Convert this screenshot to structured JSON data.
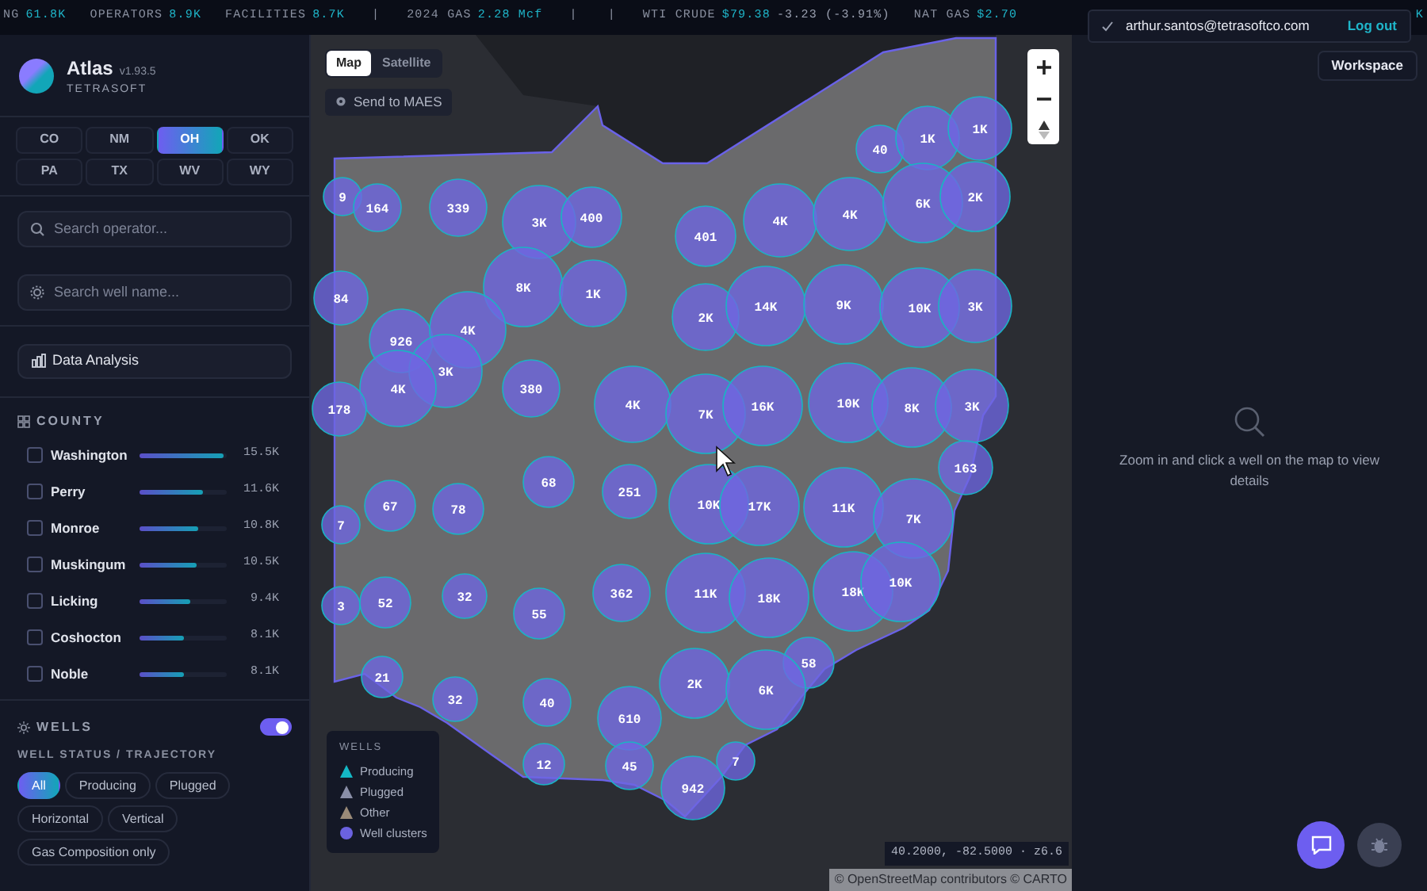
{
  "ticker": [
    {
      "kind": "stat",
      "label": "NG",
      "value": "61.8K"
    },
    {
      "kind": "stat",
      "label": "OPERATORS",
      "value": "8.9K"
    },
    {
      "kind": "stat",
      "label": "FACILITIES",
      "value": "8.7K"
    },
    {
      "kind": "separator",
      "label": "|"
    },
    {
      "kind": "stat",
      "label": "2024 GAS",
      "value": "2.28 Mcf"
    },
    {
      "kind": "separator",
      "label": "|"
    },
    {
      "kind": "separator",
      "label": "|"
    },
    {
      "kind": "quote",
      "label": "WTI CRUDE",
      "value": "$79.38",
      "change": "-3.23 (-3.91%)"
    },
    {
      "kind": "quote",
      "label": "NAT GAS",
      "value": "$2.70"
    },
    {
      "kind": "stat",
      "value": "K"
    }
  ],
  "brand": {
    "name": "Atlas",
    "version": "v1.93.5",
    "company": "TETRASOFT"
  },
  "states": [
    {
      "label": "CO",
      "selected": false
    },
    {
      "label": "NM",
      "selected": false
    },
    {
      "label": "OH",
      "selected": true
    },
    {
      "label": "OK",
      "selected": false
    },
    {
      "label": "PA",
      "selected": false
    },
    {
      "label": "TX",
      "selected": false
    },
    {
      "label": "WV",
      "selected": false
    },
    {
      "label": "WY",
      "selected": false
    }
  ],
  "search_operator": {
    "placeholder": "Search operator..."
  },
  "search_well": {
    "placeholder": "Search well name..."
  },
  "data_analysis_button": "Data Analysis",
  "county": {
    "title": "COUNTY",
    "items": [
      {
        "name": "Washington",
        "checked": false,
        "level": 0.97,
        "count": "15.5K"
      },
      {
        "name": "Perry",
        "checked": false,
        "level": 0.73,
        "count": "11.6K"
      },
      {
        "name": "Monroe",
        "checked": false,
        "level": 0.68,
        "count": "10.8K"
      },
      {
        "name": "Muskingum",
        "checked": false,
        "level": 0.66,
        "count": "10.5K"
      },
      {
        "name": "Licking",
        "checked": false,
        "level": 0.59,
        "count": "9.4K"
      },
      {
        "name": "Coshocton",
        "checked": false,
        "level": 0.51,
        "count": "8.1K"
      },
      {
        "name": "Noble",
        "checked": false,
        "level": 0.51,
        "count": "8.1K"
      }
    ]
  },
  "wells": {
    "title": "WELLS",
    "on": true,
    "filter_label": "WELL STATUS / TRAJECTORY",
    "filters": [
      {
        "label": "All",
        "selected": true
      },
      {
        "label": "Producing",
        "selected": false
      },
      {
        "label": "Plugged",
        "selected": false
      },
      {
        "label": "Horizontal",
        "selected": false
      },
      {
        "label": "Vertical",
        "selected": false
      },
      {
        "label": "Gas Composition only",
        "selected": false
      }
    ]
  },
  "map": {
    "view_modes": [
      {
        "label": "Map",
        "selected": true
      },
      {
        "label": "Satellite",
        "selected": false
      }
    ],
    "send_button": "Send to MAES",
    "clusters": [
      {
        "label": "40"
      },
      {
        "label": "1K"
      },
      {
        "label": "1K"
      },
      {
        "label": "9"
      },
      {
        "label": "164"
      },
      {
        "label": "339"
      },
      {
        "label": "3K"
      },
      {
        "label": "400"
      },
      {
        "label": "401"
      },
      {
        "label": "4K"
      },
      {
        "label": "4K"
      },
      {
        "label": "6K"
      },
      {
        "label": "2K"
      },
      {
        "label": "84"
      },
      {
        "label": "8K"
      },
      {
        "label": "1K"
      },
      {
        "label": "2K"
      },
      {
        "label": "14K"
      },
      {
        "label": "9K"
      },
      {
        "label": "10K"
      },
      {
        "label": "3K"
      },
      {
        "label": "926"
      },
      {
        "label": "4K"
      },
      {
        "label": "3K"
      },
      {
        "label": "4K"
      },
      {
        "label": "178"
      },
      {
        "label": "380"
      },
      {
        "label": "4K"
      },
      {
        "label": "7K"
      },
      {
        "label": "16K"
      },
      {
        "label": "10K"
      },
      {
        "label": "8K"
      },
      {
        "label": "3K"
      },
      {
        "label": "163"
      },
      {
        "label": "68"
      },
      {
        "label": "67"
      },
      {
        "label": "78"
      },
      {
        "label": "7"
      },
      {
        "label": "251"
      },
      {
        "label": "10K"
      },
      {
        "label": "17K"
      },
      {
        "label": "11K"
      },
      {
        "label": "7K"
      },
      {
        "label": "3"
      },
      {
        "label": "52"
      },
      {
        "label": "32"
      },
      {
        "label": "55"
      },
      {
        "label": "362"
      },
      {
        "label": "11K"
      },
      {
        "label": "18K"
      },
      {
        "label": "18K"
      },
      {
        "label": "10K"
      },
      {
        "label": "21"
      },
      {
        "label": "58"
      },
      {
        "label": "2K"
      },
      {
        "label": "6K"
      },
      {
        "label": "32"
      },
      {
        "label": "40"
      },
      {
        "label": "610"
      },
      {
        "label": "12"
      },
      {
        "label": "45"
      },
      {
        "label": "7"
      },
      {
        "label": "942"
      }
    ],
    "legend": {
      "title": "WELLS",
      "items": [
        {
          "kind": "triangle",
          "label": "Producing",
          "color": "#14b8c6"
        },
        {
          "kind": "triangle",
          "label": "Plugged",
          "color": "#8a8fa8"
        },
        {
          "kind": "triangle",
          "label": "Other",
          "color": "#9a8a78"
        },
        {
          "kind": "circle",
          "label": "Well clusters",
          "color": "#6b62e0"
        }
      ]
    },
    "coordinates": "40.2000, -82.5000 · z6.6",
    "attribution": "© OpenStreetMap contributors © CARTO"
  },
  "account": {
    "email": "arthur.santos@tetrasoftco.com",
    "logout": "Log out"
  },
  "workspace_button": "Workspace",
  "details": {
    "message": "Zoom in and click a well on the map to view details"
  }
}
